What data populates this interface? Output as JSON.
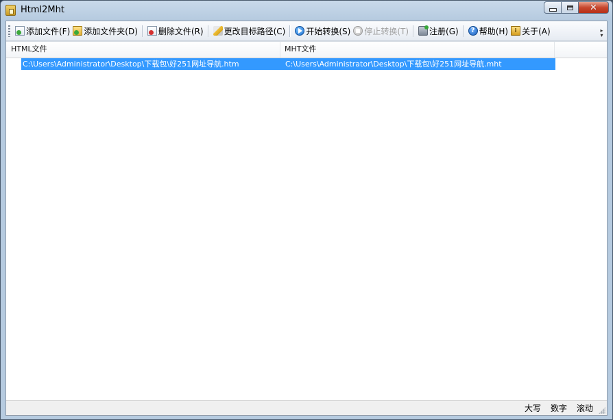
{
  "window": {
    "title": "Html2Mht",
    "controls": {
      "minimize": "minimize",
      "maximize": "maximize",
      "close": "✕"
    }
  },
  "toolbar": {
    "items": [
      {
        "label": "添加文件(F)",
        "icon": "add-file-icon",
        "enabled": true
      },
      {
        "label": "添加文件夹(D)",
        "icon": "add-folder-icon",
        "enabled": true
      },
      {
        "label": "删除文件(R)",
        "icon": "delete-file-icon",
        "enabled": true
      },
      {
        "label": "更改目标路径(C)",
        "icon": "change-path-icon",
        "enabled": true
      },
      {
        "label": "开始转换(S)",
        "icon": "start-icon",
        "enabled": true
      },
      {
        "label": "停止转换(T)",
        "icon": "stop-icon",
        "enabled": false
      },
      {
        "label": "注册(G)",
        "icon": "register-icon",
        "enabled": true
      },
      {
        "label": "帮助(H)",
        "icon": "help-icon",
        "enabled": true
      },
      {
        "label": "关于(A)",
        "icon": "about-icon",
        "enabled": true
      }
    ],
    "help_glyph": "?",
    "about_glyph": "i"
  },
  "list": {
    "columns": [
      "HTML文件",
      "MHT文件"
    ],
    "rows": [
      {
        "html": "C:\\Users\\Administrator\\Desktop\\下载包\\好251网址导航.htm",
        "mht": "C:\\Users\\Administrator\\Desktop\\下载包\\好251网址导航.mht",
        "selected": true
      }
    ]
  },
  "statusbar": {
    "items": [
      "大写",
      "数字",
      "滚动"
    ]
  },
  "colors": {
    "selection": "#3399ff",
    "window_frame": "#b6cbe0",
    "close_button": "#c7472e"
  }
}
